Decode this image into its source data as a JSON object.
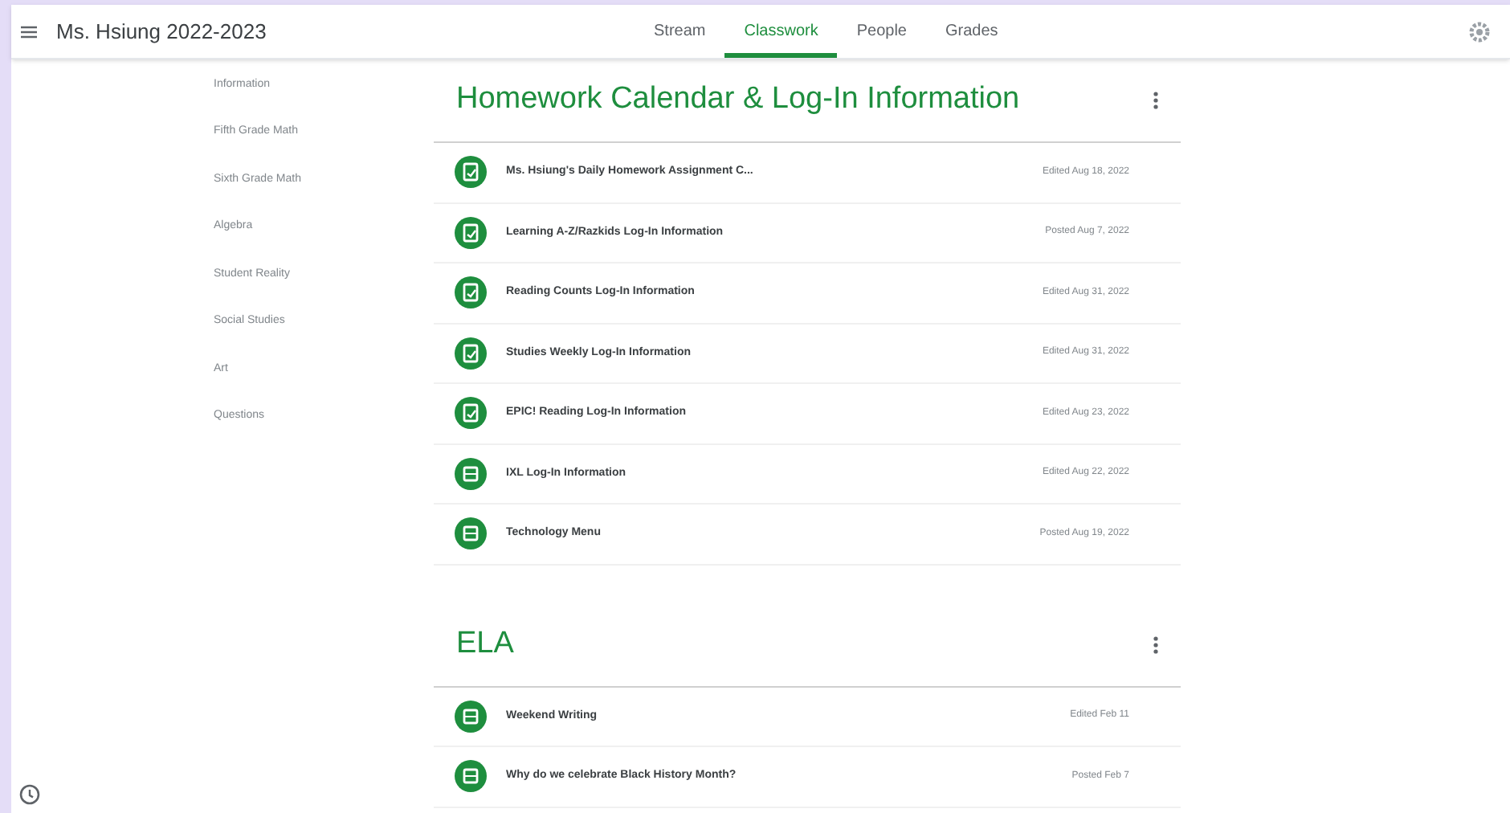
{
  "header": {
    "title": "Ms. Hsiung 2022-2023",
    "tabs": [
      {
        "label": "Stream",
        "selected": false
      },
      {
        "label": "Classwork",
        "selected": true
      },
      {
        "label": "People",
        "selected": false
      },
      {
        "label": "Grades",
        "selected": false
      }
    ]
  },
  "sidebar": {
    "items": [
      "Information",
      "Fifth Grade Math",
      "Sixth Grade Math",
      "Algebra",
      "Student Reality",
      "Social Studies",
      "Art",
      "Questions"
    ]
  },
  "topics": [
    {
      "title": "Homework Calendar & Log-In Information",
      "items": [
        {
          "kind": "assignment",
          "title": "Ms. Hsiung's Daily Homework Assignment C...",
          "date": "Edited Aug 18, 2022"
        },
        {
          "kind": "assignment",
          "title": "Learning A-Z/Razkids Log-In Information",
          "date": "Posted Aug 7, 2022"
        },
        {
          "kind": "assignment",
          "title": "Reading Counts Log-In Information",
          "date": "Edited Aug 31, 2022"
        },
        {
          "kind": "assignment",
          "title": "Studies Weekly Log-In Information",
          "date": "Edited Aug 31, 2022"
        },
        {
          "kind": "assignment",
          "title": "EPIC! Reading Log-In Information",
          "date": "Edited Aug 23, 2022"
        },
        {
          "kind": "material",
          "title": "IXL Log-In Information",
          "date": "Edited Aug 22, 2022"
        },
        {
          "kind": "material",
          "title": "Technology Menu",
          "date": "Posted Aug 19, 2022"
        }
      ]
    },
    {
      "title": "ELA",
      "items": [
        {
          "kind": "material",
          "title": "Weekend Writing",
          "date": "Edited Feb 11"
        },
        {
          "kind": "material",
          "title": "Why do we celebrate Black History Month?",
          "date": "Posted Feb 7"
        }
      ]
    }
  ]
}
